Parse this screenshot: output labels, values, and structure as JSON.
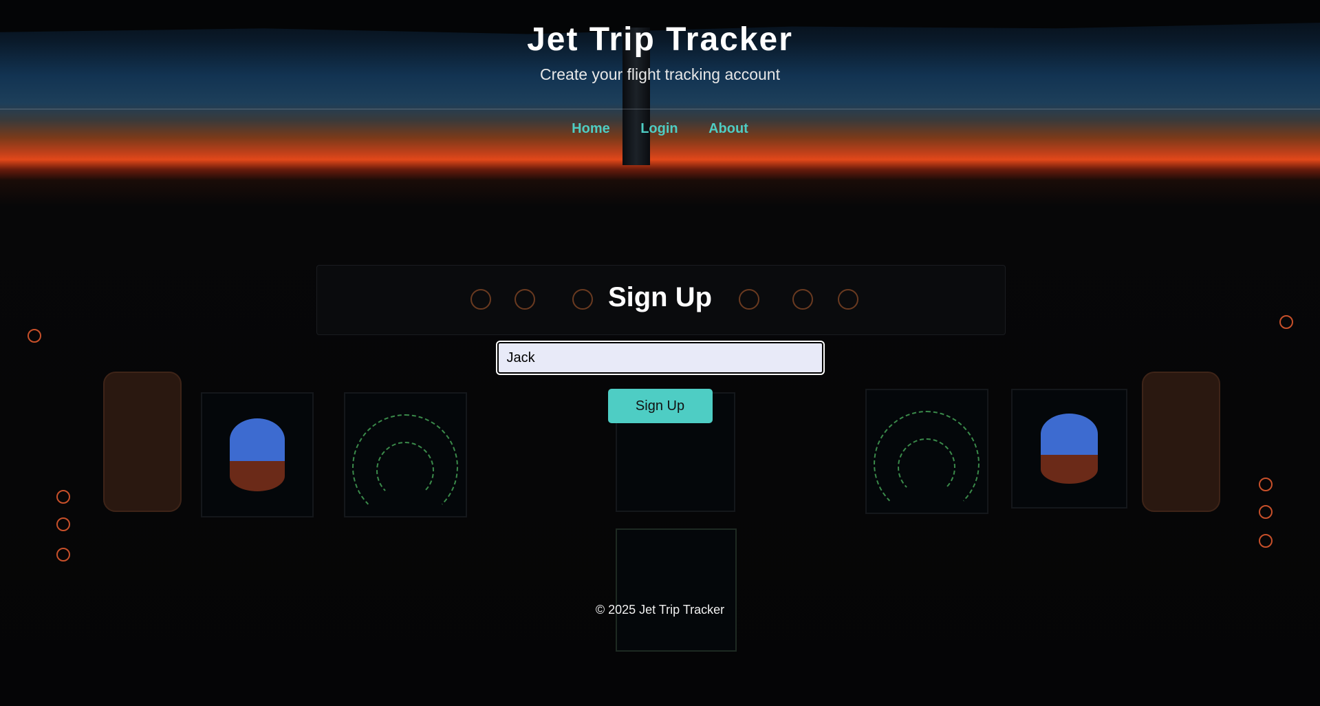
{
  "header": {
    "title": "Jet Trip Tracker",
    "subtitle": "Create your flight tracking account"
  },
  "nav": {
    "items": [
      {
        "label": "Home"
      },
      {
        "label": "Login"
      },
      {
        "label": "About"
      }
    ]
  },
  "signup_form": {
    "title": "Sign Up",
    "name_value": "Jack",
    "submit_label": "Sign Up"
  },
  "footer": {
    "text": "© 2025 Jet Trip Tracker"
  },
  "colors": {
    "accent": "#4ecdc4",
    "input_bg": "#e8eaf8",
    "title_text": "#ffffff"
  }
}
